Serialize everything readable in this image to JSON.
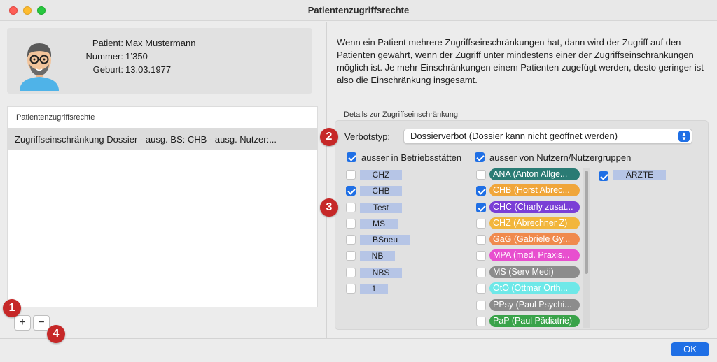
{
  "window": {
    "title": "Patientenzugriffsrechte"
  },
  "patient": {
    "labels": {
      "patient": "Patient:",
      "number": "Nummer:",
      "birth": "Geburt:"
    },
    "values": {
      "patient": "Max Mustermann",
      "number": "1’350",
      "birth": "13.03.1977"
    }
  },
  "list": {
    "header": "Patientenzugriffsrechte",
    "rows": [
      "Zugriffseinschränkung Dossier - ausg. BS: CHB - ausg. Nutzer:..."
    ]
  },
  "list_buttons": {
    "add": "+",
    "remove": "−"
  },
  "info_text": "Wenn ein Patient mehrere Zugriffseinschränkungen hat, dann wird der Zugriff auf den Patienten gewährt, wenn der Zugriff unter mindestens einer der Zugriffseinschränkungen möglich ist. Je mehr Einschränkungen einem Patienten zugefügt werden, desto geringer ist also die Einschränkung insgesamt.",
  "details": {
    "section_label": "Details zur Zugriffseinschränkung",
    "verbot_label": "Verbotstyp:",
    "verbot_value": "Dossierverbot (Dossier kann nicht geöffnet werden)",
    "ausser_bs_label": "ausser in Betriebsstätten",
    "ausser_bs_checked": true,
    "ausser_nutzer_label": "ausser von Nutzern/Nutzergruppen",
    "ausser_nutzer_checked": true,
    "betriebsstaetten": [
      {
        "label": "CHZ",
        "checked": false
      },
      {
        "label": "CHB",
        "checked": true
      },
      {
        "label": "Test",
        "checked": false
      },
      {
        "label": "MS",
        "checked": false
      },
      {
        "label": "BSneu",
        "checked": false
      },
      {
        "label": "NB",
        "checked": false
      },
      {
        "label": "NBS",
        "checked": false
      },
      {
        "label": "1",
        "checked": false
      }
    ],
    "nutzer": [
      {
        "label": "ANA (Anton Allge...",
        "checked": false,
        "color": "#2a7b74"
      },
      {
        "label": "CHB (Horst Abrec...",
        "checked": true,
        "color": "#f0a63a"
      },
      {
        "label": "CHC (Charly zusat...",
        "checked": true,
        "color": "#7a3fd6"
      },
      {
        "label": "CHZ (Abrechner Z)",
        "checked": false,
        "color": "#f2b63c"
      },
      {
        "label": "GaG (Gabriele Gy...",
        "checked": false,
        "color": "#f08a4d"
      },
      {
        "label": "MPA (med. Praxis...",
        "checked": false,
        "color": "#e84fcf"
      },
      {
        "label": "MS (Serv Medi)",
        "checked": false,
        "color": "#8c8c8c"
      },
      {
        "label": "OtO (Ottmar Orth...",
        "checked": false,
        "color": "#6ee8e8"
      },
      {
        "label": "PPsy (Paul Psychi...",
        "checked": false,
        "color": "#8c8c8c"
      },
      {
        "label": "PaP (Paul Pädiatrie)",
        "checked": false,
        "color": "#3aa34a"
      }
    ],
    "gruppen": [
      {
        "label": "ÄRZTE",
        "checked": true
      }
    ]
  },
  "badges": [
    "1",
    "2",
    "3",
    "4"
  ],
  "ok_label": "OK"
}
